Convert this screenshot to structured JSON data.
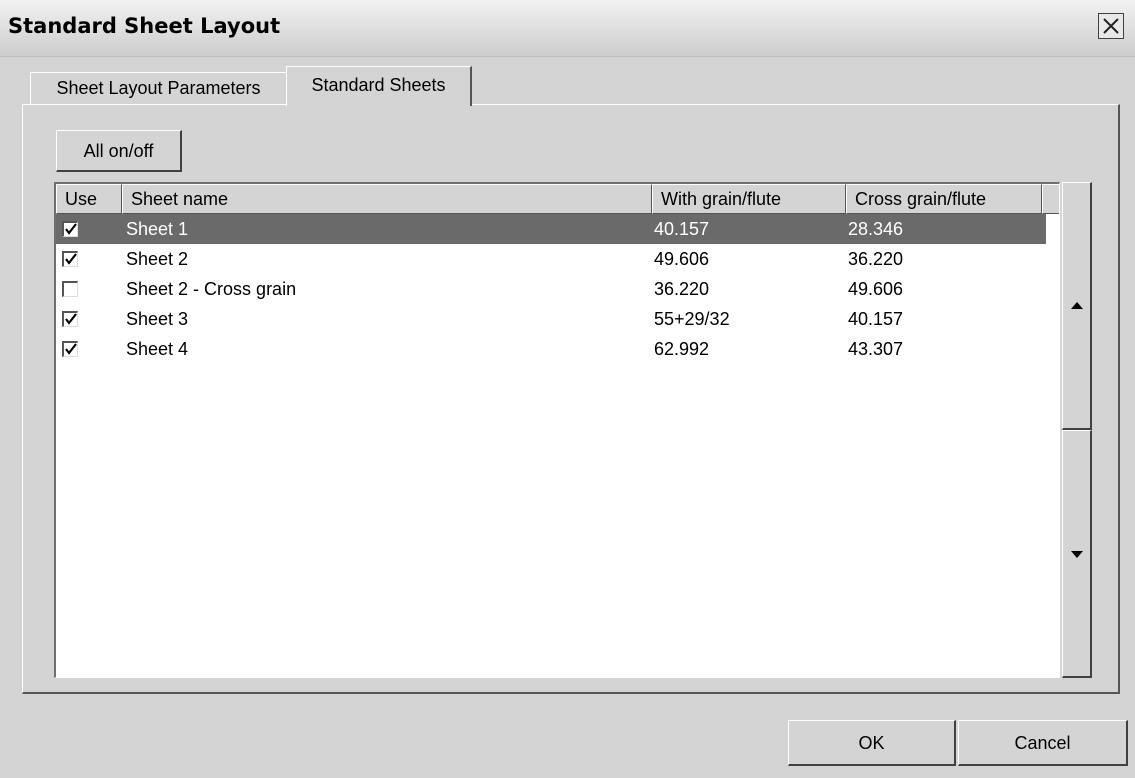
{
  "window": {
    "title": "Standard Sheet Layout"
  },
  "tabs": [
    {
      "label": "Sheet Layout Parameters"
    },
    {
      "label": "Standard Sheets"
    }
  ],
  "toolbar": {
    "all_toggle_label": "All on/off"
  },
  "table": {
    "headers": [
      "Use",
      "Sheet name",
      "With grain/flute",
      "Cross grain/flute"
    ],
    "rows": [
      {
        "use": true,
        "name": "Sheet 1",
        "with_grain": "40.157",
        "cross_grain": "28.346",
        "selected": true
      },
      {
        "use": true,
        "name": "Sheet 2",
        "with_grain": "49.606",
        "cross_grain": "36.220",
        "selected": false
      },
      {
        "use": false,
        "name": "Sheet 2 - Cross grain",
        "with_grain": "36.220",
        "cross_grain": "49.606",
        "selected": false
      },
      {
        "use": true,
        "name": "Sheet 3",
        "with_grain": "55+29/32",
        "cross_grain": "40.157",
        "selected": false
      },
      {
        "use": true,
        "name": "Sheet 4",
        "with_grain": "62.992",
        "cross_grain": "43.307",
        "selected": false
      }
    ]
  },
  "footer": {
    "ok_label": "OK",
    "cancel_label": "Cancel"
  },
  "colors": {
    "selection": "#6a6a6a",
    "face": "#d4d4d4"
  }
}
